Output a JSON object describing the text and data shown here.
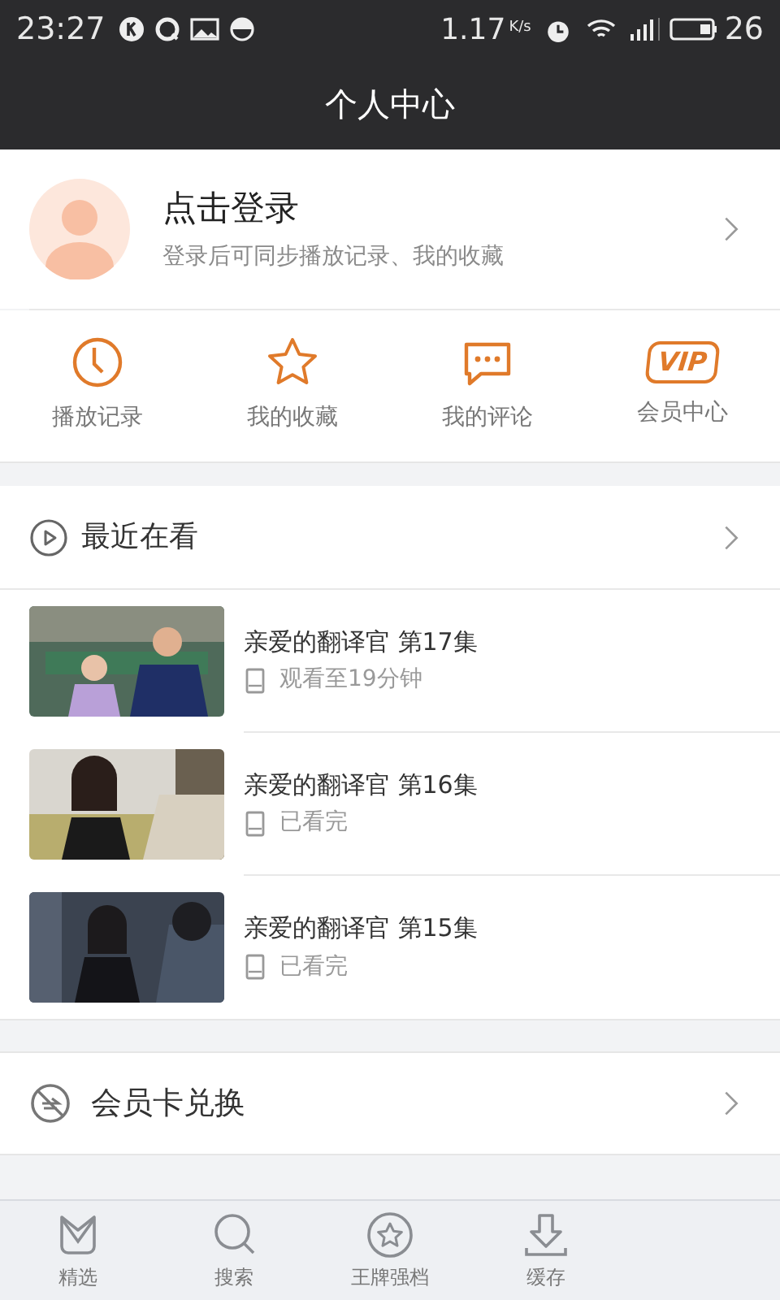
{
  "status_bar": {
    "time": "23:27",
    "speed": "1.17",
    "speed_unit": "K/s",
    "battery": "26"
  },
  "title": "个人中心",
  "profile": {
    "name": "点击登录",
    "hint": "登录后可同步播放记录、我的收藏"
  },
  "shortcuts": [
    {
      "kind": "clock",
      "label": "播放记录"
    },
    {
      "kind": "star",
      "label": "我的收藏"
    },
    {
      "kind": "comment",
      "label": "我的评论"
    },
    {
      "kind": "vip",
      "label": "会员中心",
      "badge": "VIP"
    }
  ],
  "recent": {
    "title": "最近在看",
    "items": [
      {
        "title": "亲爱的翻译官 第17集",
        "progress": "观看至19分钟",
        "kind": "picture"
      },
      {
        "title": "亲爱的翻译官 第16集",
        "progress": "已看完",
        "kind": "picture"
      },
      {
        "title": "亲爱的翻译官 第15集",
        "progress": "已看完",
        "kind": "picture"
      }
    ]
  },
  "card_exchange": {
    "label": "会员卡兑换"
  },
  "tab_bar": [
    {
      "kind": "m",
      "label": "精选"
    },
    {
      "kind": "search",
      "label": "搜索"
    },
    {
      "kind": "star",
      "label": "王牌强档"
    },
    {
      "kind": "download",
      "label": "缓存"
    }
  ]
}
